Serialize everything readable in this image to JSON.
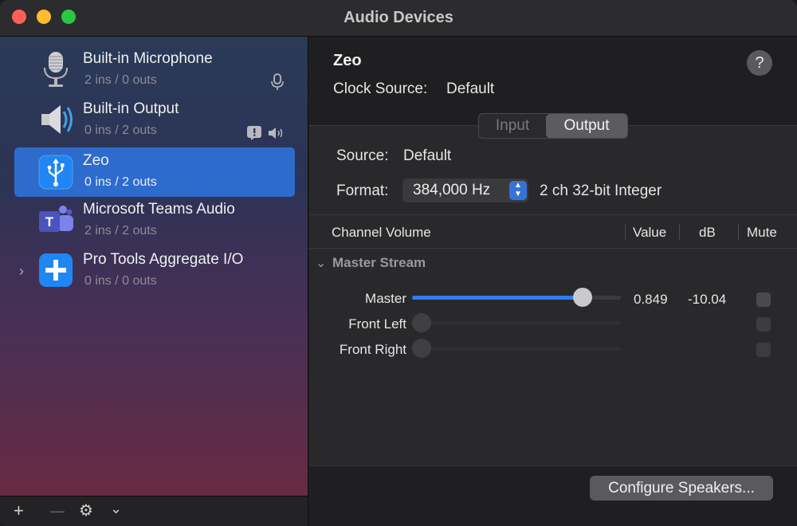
{
  "window": {
    "title": "Audio Devices"
  },
  "devices": [
    {
      "name": "Built-in Microphone",
      "io": "2 ins / 0 outs",
      "icon": "microphone-icon",
      "badge": "mic-badge-icon"
    },
    {
      "name": "Built-in Output",
      "io": "0 ins / 2 outs",
      "icon": "speaker-icon",
      "badge": "alert-speaker-badge-icon"
    },
    {
      "name": "Zeo",
      "io": "0 ins / 2 outs",
      "icon": "usb-icon",
      "selected": true
    },
    {
      "name": "Microsoft Teams Audio",
      "io": "2 ins / 2 outs",
      "icon": "teams-icon"
    },
    {
      "name": "Pro Tools Aggregate I/O",
      "io": "0 ins / 0 outs",
      "icon": "aggregate-plus-icon"
    }
  ],
  "sidebar_toolbar": {
    "add": "+",
    "remove": "—",
    "gear": "⚙",
    "chevron": "⌄"
  },
  "detail": {
    "device_name": "Zeo",
    "clock_label": "Clock Source:",
    "clock_value": "Default",
    "help": "?",
    "tabs": {
      "input": "Input",
      "output": "Output",
      "selected": "Output"
    },
    "source_label": "Source:",
    "source_value": "Default",
    "format_label": "Format:",
    "format_value": "384,000 Hz",
    "format_desc": "2 ch 32-bit Integer"
  },
  "table": {
    "headers": {
      "channel": "Channel Volume",
      "value": "Value",
      "db": "dB",
      "mute": "Mute"
    },
    "group": "Master Stream",
    "channels": [
      {
        "name": "Master",
        "level": 0.849,
        "value": "0.849",
        "db": "-10.04",
        "enabled": true
      },
      {
        "name": "Front Left",
        "level": 0,
        "value": "",
        "db": "",
        "enabled": false
      },
      {
        "name": "Front Right",
        "level": 0,
        "value": "",
        "db": "",
        "enabled": false
      }
    ]
  },
  "configure_button": "Configure Speakers...",
  "colors": {
    "accent": "#2f7df6",
    "selection": "#2d6ccc"
  }
}
